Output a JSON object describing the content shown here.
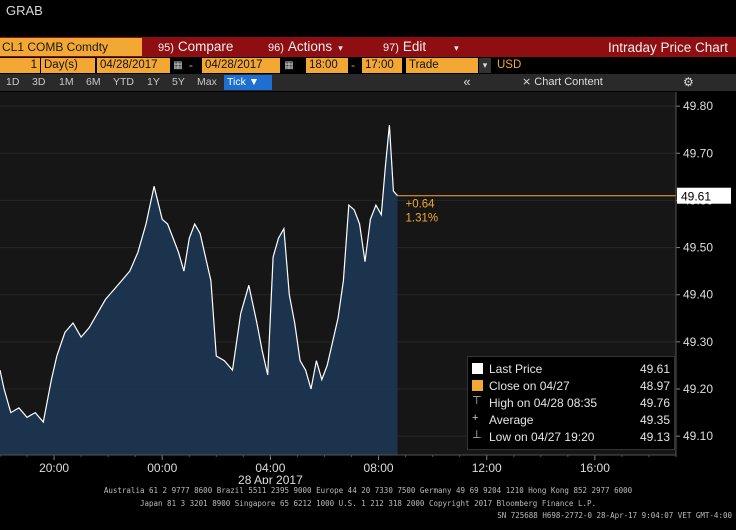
{
  "window": {
    "title": "GRAB"
  },
  "toolbar": {
    "ticker": "CL1 COMB Comdty",
    "compare": {
      "num": "95)",
      "label": "Compare"
    },
    "actions": {
      "num": "96)",
      "label": "Actions"
    },
    "edit": {
      "num": "97)",
      "label": "Edit"
    },
    "chart_title": "Intraday Price Chart"
  },
  "options": {
    "days_value": "1",
    "days_unit": "Day(s)",
    "start_date": "04/28/2017",
    "end_date": "04/28/2017",
    "start_time": "18:00",
    "end_time": "17:00",
    "field": "Trade",
    "currency": "USD"
  },
  "timeframes": [
    "1D",
    "3D",
    "1M",
    "6M",
    "YTD",
    "1Y",
    "5Y",
    "Max"
  ],
  "tick_button": "Tick ▼",
  "chart_content_label": "Chart Content",
  "colors": {
    "accent": "#f3a833",
    "menubar": "#8e0e12",
    "area": "#1b3550",
    "line": "#ffffff"
  },
  "annotation": {
    "change": "+0.64",
    "percent": "1.31%",
    "last_tag": "49.61"
  },
  "legend": {
    "last_price": {
      "label": "Last Price",
      "value": "49.61"
    },
    "close": {
      "label": "Close on 04/27",
      "value": "48.97"
    },
    "high": {
      "label": "High on 04/28 08:35",
      "value": "49.76"
    },
    "average": {
      "label": "Average",
      "value": "49.35"
    },
    "low": {
      "label": "Low on 04/27 19:20",
      "value": "49.13"
    }
  },
  "footer": {
    "line1": "Australia 61 2 9777 8600 Brazil 5511 2395 9000 Europe 44 20 7330 7500 Germany 49 69 9204 1210 Hong Kong 852 2977 6000",
    "line2": "Japan 81 3 3201 8900        Singapore 65 6212 1000        U.S. 1 212 318 2000        Copyright 2017 Bloomberg Finance L.P.",
    "line3": "SN 725688 H698-2772-0 28-Apr-17  9:04:07 VET  GMT-4:00"
  },
  "chart_data": {
    "type": "area",
    "x_ticks": [
      "20:00",
      "00:00",
      "04:00",
      "08:00",
      "12:00",
      "16:00"
    ],
    "x_ticks_hours": [
      2,
      6,
      10,
      14,
      18,
      22
    ],
    "x_sublabel": "28 Apr 2017",
    "y_ticks": [
      49.1,
      49.2,
      49.3,
      49.4,
      49.5,
      49.6,
      49.7,
      49.8
    ],
    "y_tick_labels": [
      "49.10",
      "49.20",
      "49.30",
      "49.40",
      "49.50",
      "49.60",
      "49.70",
      "49.80"
    ],
    "ylim": [
      49.06,
      49.83
    ],
    "x_range_hours": [
      0,
      25
    ],
    "last_price": 49.61,
    "series": [
      {
        "x": [
          0,
          0.15,
          0.4,
          0.7,
          1,
          1.3,
          1.6,
          1.9,
          2.1,
          2.4,
          2.7,
          3,
          3.3,
          3.6,
          3.9,
          4.2,
          4.5,
          4.8,
          5.1,
          5.4,
          5.7,
          6,
          6.2,
          6.4,
          6.6,
          6.8,
          7,
          7.2,
          7.4,
          7.6,
          7.8,
          8,
          8.3,
          8.6,
          8.9,
          9.2,
          9.5,
          9.7,
          9.9,
          10.1,
          10.3,
          10.5,
          10.7,
          10.9,
          11.1,
          11.3,
          11.5,
          11.7,
          11.9,
          12.1,
          12.3,
          12.5,
          12.7,
          12.9,
          13.1,
          13.3,
          13.5,
          13.7,
          13.9,
          14.1,
          14.25,
          14.4,
          14.55,
          14.7
        ],
        "y": [
          49.24,
          49.2,
          49.15,
          49.16,
          49.14,
          49.15,
          49.13,
          49.22,
          49.27,
          49.32,
          49.34,
          49.31,
          49.33,
          49.36,
          49.39,
          49.41,
          49.43,
          49.45,
          49.49,
          49.55,
          49.63,
          49.56,
          49.55,
          49.52,
          49.49,
          49.45,
          49.52,
          49.55,
          49.53,
          49.48,
          49.43,
          49.27,
          49.26,
          49.24,
          49.36,
          49.42,
          49.34,
          49.28,
          49.23,
          49.48,
          49.52,
          49.54,
          49.4,
          49.34,
          49.26,
          49.24,
          49.2,
          49.26,
          49.22,
          49.25,
          49.3,
          49.35,
          49.43,
          49.59,
          49.58,
          49.55,
          49.47,
          49.56,
          49.59,
          49.57,
          49.67,
          49.76,
          49.62,
          49.61
        ]
      }
    ]
  }
}
